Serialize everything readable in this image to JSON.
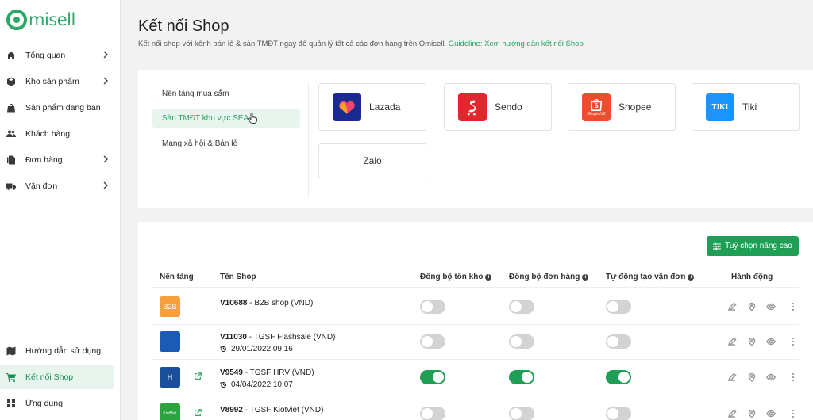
{
  "brand": {
    "name": "misell"
  },
  "sidebar": {
    "items": [
      {
        "label": "Tổng quan",
        "icon": "home-icon",
        "chevron": true
      },
      {
        "label": "Kho sản phẩm",
        "icon": "box-icon",
        "chevron": true
      },
      {
        "label": "Sản phẩm đang bán",
        "icon": "bag-icon",
        "chevron": false
      },
      {
        "label": "Khách hàng",
        "icon": "users-icon",
        "chevron": false
      },
      {
        "label": "Đơn hàng",
        "icon": "document-icon",
        "chevron": true
      },
      {
        "label": "Vận đơn",
        "icon": "truck-icon",
        "chevron": true
      }
    ],
    "bottom": [
      {
        "label": "Hướng dẫn sử dụng",
        "icon": "map-icon"
      },
      {
        "label": "Kết nối Shop",
        "icon": "cart-icon",
        "active": true
      },
      {
        "label": "Ứng dụng",
        "icon": "grid-icon"
      }
    ]
  },
  "header": {
    "title": "Kết nối Shop",
    "description": "Kết nối shop với kênh bán lẻ & sàn TMĐT ngay để quản lý tất cả các đơn hàng trên Omisell.",
    "guideline_link": "Guideline: Xem hướng dẫn kết nối Shop"
  },
  "categories": [
    {
      "label": "Nền tảng mua sắm",
      "selected": false
    },
    {
      "label": "Sàn TMĐT khu vực SEA",
      "selected": true
    },
    {
      "label": "Mạng xã hội & Bán lẻ",
      "selected": false
    }
  ],
  "platforms": [
    {
      "name": "Lazada",
      "color": "#1b2a8f",
      "icon": "lazada-logo-icon"
    },
    {
      "name": "Sendo",
      "color": "#e1262d",
      "icon": "sendo-logo-icon"
    },
    {
      "name": "Shopee",
      "color": "#ee4d2d",
      "icon": "shopee-logo-icon",
      "sub": "ShopeeV2"
    },
    {
      "name": "Tiki",
      "color": "#1a94ff",
      "icon": "tiki-logo-icon",
      "mark": "TIKI"
    },
    {
      "name": "Zalo",
      "color": "",
      "icon": ""
    }
  ],
  "advanced_button": "Tuỳ chọn nâng cao",
  "table": {
    "headers": {
      "platform": "Nền tảng",
      "shop": "Tên Shop",
      "sync_stock": "Đồng bộ tồn kho",
      "sync_orders": "Đồng bộ đơn hàng",
      "auto_waybill": "Tự động tạo vận đơn",
      "actions": "Hành động"
    },
    "rows": [
      {
        "logo_text": "B2B",
        "logo_color": "#f5a03b",
        "code": "V10688",
        "name": " - B2B shop (VND)",
        "date": "",
        "external": false,
        "stock": false,
        "orders": false,
        "waybill": false
      },
      {
        "logo_text": "",
        "logo_color": "#1a5bb8",
        "code": "V11030",
        "name": " - TGSF Flashsale (VND)",
        "date": "29/01/2022 09:16",
        "external": false,
        "stock": false,
        "orders": false,
        "waybill": false
      },
      {
        "logo_text": "H",
        "logo_color": "#1a4f9c",
        "code": "V9549",
        "name": " - TGSF HRV (VND)",
        "date": "04/04/2022 10:07",
        "external": true,
        "stock": true,
        "orders": true,
        "waybill": true
      },
      {
        "logo_text": "KiotViet",
        "logo_color": "#2aa43f",
        "code": "V8992",
        "name": " - TGSF Kiotviet (VND)",
        "date": "",
        "external": true,
        "stock": false,
        "orders": false,
        "waybill": false
      }
    ]
  },
  "colors": {
    "accent": "#1f9e56",
    "active_bg": "#e8f5ee"
  }
}
